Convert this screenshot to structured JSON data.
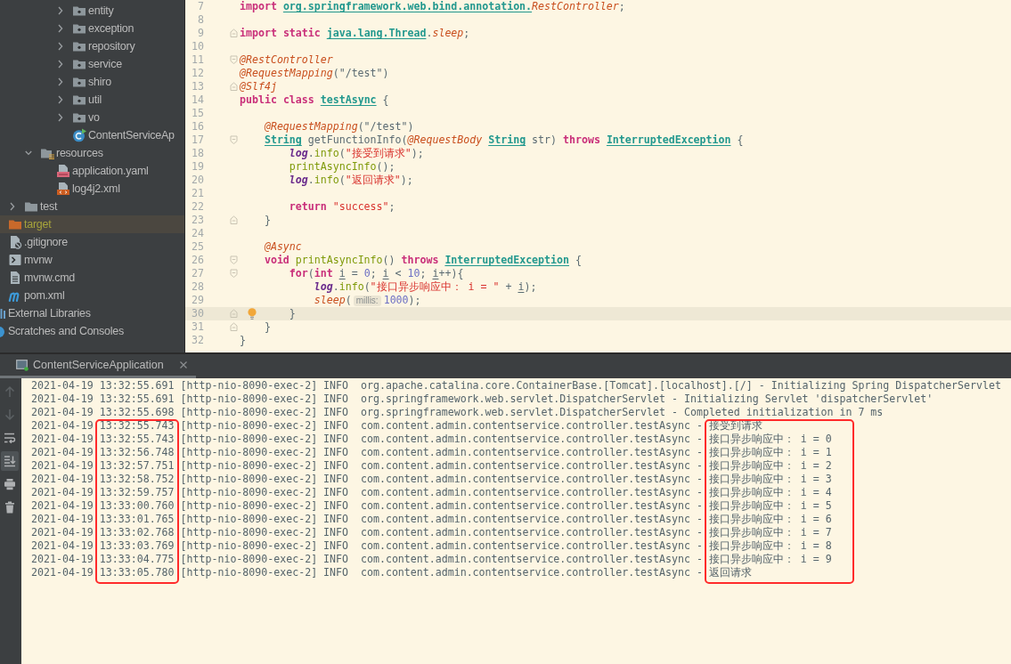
{
  "project_tree": [
    {
      "children": [
        {
          "children": [
            {
              "children": [
                {
                  "children": [
                    {
                      "children": [
                        {
                          "label": "entity",
                          "kind": "package",
                          "expanded": false,
                          "selected": false
                        },
                        {
                          "label": "exception",
                          "kind": "package",
                          "expanded": false,
                          "selected": false
                        },
                        {
                          "label": "repository",
                          "kind": "package",
                          "expanded": false,
                          "selected": false
                        },
                        {
                          "label": "service",
                          "kind": "package",
                          "expanded": false,
                          "selected": false
                        },
                        {
                          "label": "shiro",
                          "kind": "package",
                          "expanded": false,
                          "selected": false
                        },
                        {
                          "label": "util",
                          "kind": "package",
                          "expanded": false,
                          "selected": false
                        },
                        {
                          "label": "vo",
                          "kind": "package",
                          "expanded": false,
                          "selected": false
                        },
                        {
                          "label": "ContentServiceAp",
                          "kind": "spring-class",
                          "selected": false
                        }
                      ]
                    }
                  ]
                },
                {
                  "label": "resources",
                  "kind": "resources",
                  "expanded": true,
                  "selected": false,
                  "children": [
                    {
                      "label": "application.yaml",
                      "kind": "yaml",
                      "selected": false
                    },
                    {
                      "label": "log4j2.xml",
                      "kind": "xml",
                      "selected": false
                    }
                  ]
                }
              ]
            },
            {
              "label": "test",
              "kind": "folder",
              "expanded": false,
              "selected": false
            }
          ]
        },
        {
          "label": "target",
          "kind": "excluded",
          "selected": true
        },
        {
          "label": ".gitignore",
          "kind": "ignore",
          "selected": false
        },
        {
          "label": "mvnw",
          "kind": "script",
          "selected": false
        },
        {
          "label": "mvnw.cmd",
          "kind": "text",
          "selected": false
        },
        {
          "label": "pom.xml",
          "kind": "maven",
          "selected": false
        }
      ]
    },
    {
      "label": "External Libraries",
      "kind": "libraries",
      "selected": false
    },
    {
      "label": "Scratches and Consoles",
      "kind": "scratches",
      "selected": false
    }
  ],
  "editor": {
    "lines": [
      {
        "number": "7",
        "current": false,
        "tokens": [
          {
            "kind": "keyword",
            "text": "import "
          },
          {
            "kind": "package",
            "text": "org.springframework.web.bind.annotation."
          },
          {
            "kind": "annotation",
            "text": "RestController"
          },
          {
            "kind": "plain",
            "text": ";"
          }
        ]
      },
      {
        "number": "8",
        "current": false
      },
      {
        "number": "9",
        "current": false,
        "fold": {
          "kind": "end"
        },
        "tokens": [
          {
            "kind": "keyword",
            "text": "import "
          },
          {
            "kind": "keyword",
            "text": "static "
          },
          {
            "kind": "package",
            "text": "java.lang.Thread"
          },
          {
            "kind": "plain",
            "text": "."
          },
          {
            "kind": "static",
            "text": "sleep"
          },
          {
            "kind": "plain",
            "text": ";"
          }
        ]
      },
      {
        "number": "10",
        "current": false
      },
      {
        "number": "11",
        "current": false,
        "fold": {
          "kind": "start"
        },
        "tokens": [
          {
            "kind": "annotation",
            "text": "@RestController"
          }
        ]
      },
      {
        "number": "12",
        "current": false,
        "tokens": [
          {
            "kind": "annotation",
            "text": "@RequestMapping"
          },
          {
            "kind": "plain",
            "text": "(\"/test\")"
          }
        ]
      },
      {
        "number": "13",
        "current": false,
        "fold": {
          "kind": "end"
        },
        "tokens": [
          {
            "kind": "annotation",
            "text": "@Slf4j"
          }
        ]
      },
      {
        "number": "14",
        "current": false,
        "tokens": [
          {
            "kind": "keyword",
            "text": "public "
          },
          {
            "kind": "keyword",
            "text": "class "
          },
          {
            "kind": "type",
            "text": "testAsync"
          },
          {
            "kind": "plain",
            "text": " {"
          }
        ]
      },
      {
        "number": "15",
        "current": false
      },
      {
        "number": "16",
        "current": false,
        "tokens": [
          {
            "kind": "annotation",
            "text": "    @RequestMapping"
          },
          {
            "kind": "plain",
            "text": "(\"/test\")"
          }
        ]
      },
      {
        "number": "17",
        "current": false,
        "fold": {
          "kind": "start"
        },
        "tokens": [
          {
            "kind": "type",
            "text": "    String"
          },
          {
            "kind": "plain",
            "text": " getFunctionInfo("
          },
          {
            "kind": "annotation",
            "text": "@RequestBody "
          },
          {
            "kind": "type",
            "text": "String"
          },
          {
            "kind": "plain",
            "text": " str) "
          },
          {
            "kind": "keyword",
            "text": "throws "
          },
          {
            "kind": "type",
            "text": "InterruptedException"
          },
          {
            "kind": "plain",
            "text": " {"
          }
        ]
      },
      {
        "number": "18",
        "current": false,
        "tokens": [
          {
            "kind": "field",
            "text": "        log"
          },
          {
            "kind": "plain",
            "text": "."
          },
          {
            "kind": "call",
            "text": "info"
          },
          {
            "kind": "plain",
            "text": "("
          },
          {
            "kind": "string",
            "text": "\"接受到请求\""
          },
          {
            "kind": "plain",
            "text": ");"
          }
        ]
      },
      {
        "number": "19",
        "current": false,
        "tokens": [
          {
            "kind": "call",
            "text": "        printAsyncInfo"
          },
          {
            "kind": "plain",
            "text": "();"
          }
        ]
      },
      {
        "number": "20",
        "current": false,
        "tokens": [
          {
            "kind": "field",
            "text": "        log"
          },
          {
            "kind": "plain",
            "text": "."
          },
          {
            "kind": "call",
            "text": "info"
          },
          {
            "kind": "plain",
            "text": "("
          },
          {
            "kind": "string",
            "text": "\"返回请求\""
          },
          {
            "kind": "plain",
            "text": ");"
          }
        ]
      },
      {
        "number": "21",
        "current": false
      },
      {
        "number": "22",
        "current": false,
        "tokens": [
          {
            "kind": "keyword",
            "text": "        return "
          },
          {
            "kind": "string",
            "text": "\"success\""
          },
          {
            "kind": "plain",
            "text": ";"
          }
        ]
      },
      {
        "number": "23",
        "current": false,
        "fold": {
          "kind": "end"
        },
        "tokens": [
          {
            "kind": "plain",
            "text": "    }"
          }
        ]
      },
      {
        "number": "24",
        "current": false
      },
      {
        "number": "25",
        "current": false,
        "tokens": [
          {
            "kind": "annotation",
            "text": "    @Async"
          }
        ]
      },
      {
        "number": "26",
        "current": false,
        "fold": {
          "kind": "start"
        },
        "tokens": [
          {
            "kind": "keyword",
            "text": "    void "
          },
          {
            "kind": "call",
            "text": "printAsyncInfo"
          },
          {
            "kind": "plain",
            "text": "() "
          },
          {
            "kind": "keyword",
            "text": "throws "
          },
          {
            "kind": "type",
            "text": "InterruptedException"
          },
          {
            "kind": "plain",
            "text": " {"
          }
        ]
      },
      {
        "number": "27",
        "current": false,
        "fold": {
          "kind": "start"
        },
        "tokens": [
          {
            "kind": "keyword",
            "text": "        for"
          },
          {
            "kind": "plain",
            "text": "("
          },
          {
            "kind": "keyword",
            "text": "int "
          },
          {
            "kind": "variable",
            "text": "i"
          },
          {
            "kind": "plain",
            "text": " = "
          },
          {
            "kind": "number",
            "text": "0"
          },
          {
            "kind": "plain",
            "text": "; "
          },
          {
            "kind": "variable",
            "text": "i"
          },
          {
            "kind": "plain",
            "text": " < "
          },
          {
            "kind": "number",
            "text": "10"
          },
          {
            "kind": "plain",
            "text": "; "
          },
          {
            "kind": "variable",
            "text": "i"
          },
          {
            "kind": "plain",
            "text": "++){"
          }
        ]
      },
      {
        "number": "28",
        "current": false,
        "tokens": [
          {
            "kind": "field",
            "text": "            log"
          },
          {
            "kind": "plain",
            "text": "."
          },
          {
            "kind": "call",
            "text": "info"
          },
          {
            "kind": "plain",
            "text": "("
          },
          {
            "kind": "string",
            "text": "\"接口异步响应中： i = \""
          },
          {
            "kind": "plain",
            "text": " + "
          },
          {
            "kind": "variable",
            "text": "i"
          },
          {
            "kind": "plain",
            "text": ");"
          }
        ]
      },
      {
        "number": "29",
        "current": false,
        "tokens": [
          {
            "kind": "static",
            "text": "            sleep"
          },
          {
            "kind": "plain",
            "text": "("
          },
          {
            "kind": "hint",
            "text": "millis:"
          },
          {
            "kind": "number",
            "text": "1000"
          },
          {
            "kind": "plain",
            "text": ");"
          }
        ]
      },
      {
        "number": "30",
        "current": true,
        "fold": {
          "kind": "end"
        },
        "tokens": [
          {
            "kind": "plain",
            "text": "        }"
          }
        ]
      },
      {
        "number": "31",
        "current": false,
        "fold": {
          "kind": "end"
        },
        "tokens": [
          {
            "kind": "plain",
            "text": "    }"
          }
        ]
      },
      {
        "number": "32",
        "current": false,
        "tokens": [
          {
            "kind": "plain",
            "text": "}"
          }
        ]
      }
    ]
  },
  "run_panel": {
    "tabs": [
      {
        "label": "ContentServiceApplication",
        "selected": true
      }
    ],
    "toolbar": [
      {
        "kind": "up",
        "disabled": true,
        "on": false
      },
      {
        "kind": "down",
        "disabled": true,
        "on": false
      },
      {
        "kind": "soft-wrap",
        "disabled": false,
        "on": false
      },
      {
        "kind": "scroll-to-end",
        "disabled": false,
        "on": true
      },
      {
        "kind": "print",
        "disabled": false,
        "on": false
      },
      {
        "kind": "clear",
        "disabled": false,
        "on": false
      }
    ],
    "lines": [
      {
        "date": "2021-04-19",
        "time": "13:32:55.691",
        "thread": "[http-nio-8090-exec-2]",
        "level": "INFO",
        "logger": "org.apache.catalina.core.ContainerBase.[Tomcat].[localhost].[/]",
        "separator": "-",
        "message": "Initializing Spring DispatcherServlet"
      },
      {
        "date": "2021-04-19",
        "time": "13:32:55.691",
        "thread": "[http-nio-8090-exec-2]",
        "level": "INFO",
        "logger": "org.springframework.web.servlet.DispatcherServlet",
        "separator": "-",
        "message": "Initializing Servlet 'dispatcherServlet'"
      },
      {
        "date": "2021-04-19",
        "time": "13:32:55.698",
        "thread": "[http-nio-8090-exec-2]",
        "level": "INFO",
        "logger": "org.springframework.web.servlet.DispatcherServlet",
        "separator": "-",
        "message": "Completed initialization in 7 ms"
      }
    ],
    "marked_block": {
      "time_boxed": true,
      "message_boxed": true,
      "lines": [
        {
          "date": "2021-04-19",
          "time": "13:32:55.743",
          "thread": "[http-nio-8090-exec-2]",
          "level": "INFO",
          "logger": "com.content.admin.contentservice.controller.testAsync",
          "separator": "-",
          "message": "接受到请求"
        },
        {
          "date": "2021-04-19",
          "time": "13:32:55.743",
          "thread": "[http-nio-8090-exec-2]",
          "level": "INFO",
          "logger": "com.content.admin.contentservice.controller.testAsync",
          "separator": "-",
          "message": "接口异步响应中： i = 0"
        },
        {
          "date": "2021-04-19",
          "time": "13:32:56.748",
          "thread": "[http-nio-8090-exec-2]",
          "level": "INFO",
          "logger": "com.content.admin.contentservice.controller.testAsync",
          "separator": "-",
          "message": "接口异步响应中： i = 1"
        },
        {
          "date": "2021-04-19",
          "time": "13:32:57.751",
          "thread": "[http-nio-8090-exec-2]",
          "level": "INFO",
          "logger": "com.content.admin.contentservice.controller.testAsync",
          "separator": "-",
          "message": "接口异步响应中： i = 2"
        },
        {
          "date": "2021-04-19",
          "time": "13:32:58.752",
          "thread": "[http-nio-8090-exec-2]",
          "level": "INFO",
          "logger": "com.content.admin.contentservice.controller.testAsync",
          "separator": "-",
          "message": "接口异步响应中： i = 3"
        },
        {
          "date": "2021-04-19",
          "time": "13:32:59.757",
          "thread": "[http-nio-8090-exec-2]",
          "level": "INFO",
          "logger": "com.content.admin.contentservice.controller.testAsync",
          "separator": "-",
          "message": "接口异步响应中： i = 4"
        },
        {
          "date": "2021-04-19",
          "time": "13:33:00.760",
          "thread": "[http-nio-8090-exec-2]",
          "level": "INFO",
          "logger": "com.content.admin.contentservice.controller.testAsync",
          "separator": "-",
          "message": "接口异步响应中： i = 5"
        },
        {
          "date": "2021-04-19",
          "time": "13:33:01.765",
          "thread": "[http-nio-8090-exec-2]",
          "level": "INFO",
          "logger": "com.content.admin.contentservice.controller.testAsync",
          "separator": "-",
          "message": "接口异步响应中： i = 6"
        },
        {
          "date": "2021-04-19",
          "time": "13:33:02.768",
          "thread": "[http-nio-8090-exec-2]",
          "level": "INFO",
          "logger": "com.content.admin.contentservice.controller.testAsync",
          "separator": "-",
          "message": "接口异步响应中： i = 7"
        },
        {
          "date": "2021-04-19",
          "time": "13:33:03.769",
          "thread": "[http-nio-8090-exec-2]",
          "level": "INFO",
          "logger": "com.content.admin.contentservice.controller.testAsync",
          "separator": "-",
          "message": "接口异步响应中： i = 8"
        },
        {
          "date": "2021-04-19",
          "time": "13:33:04.775",
          "thread": "[http-nio-8090-exec-2]",
          "level": "INFO",
          "logger": "com.content.admin.contentservice.controller.testAsync",
          "separator": "-",
          "message": "接口异步响应中： i = 9"
        },
        {
          "date": "2021-04-19",
          "time": "13:33:05.780",
          "thread": "[http-nio-8090-exec-2]",
          "level": "INFO",
          "logger": "com.content.admin.contentservice.controller.testAsync",
          "separator": "-",
          "message": "返回请求"
        }
      ]
    }
  }
}
